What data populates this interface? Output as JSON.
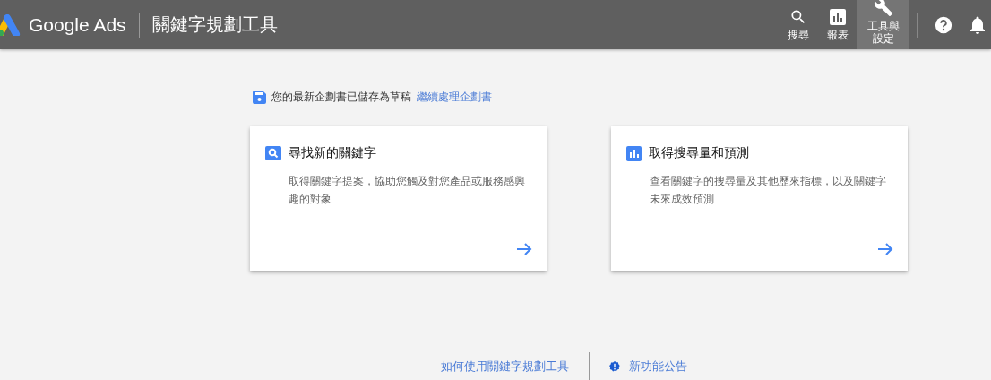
{
  "header": {
    "product": "Google Ads",
    "page_title": "關鍵字規劃工具",
    "nav": [
      {
        "kind": "search",
        "label": "搜尋",
        "selected": false
      },
      {
        "kind": "reports",
        "label": "報表",
        "selected": false
      },
      {
        "kind": "tools",
        "label": "工具與設定",
        "selected": true
      }
    ],
    "actions": [
      {
        "kind": "help"
      },
      {
        "kind": "bell"
      }
    ]
  },
  "draft_notice": {
    "text": "您的最新企劃書已儲存為草稿",
    "link": "繼續處理企劃書"
  },
  "cards": [
    {
      "kind": "search",
      "title": "尋找新的關鍵字",
      "description": "取得關鍵字提案，協助您觸及對您產品或服務感興趣的對象"
    },
    {
      "kind": "chart",
      "title": "取得搜尋量和預測",
      "description": "查看關鍵字的搜尋量及其他歷來指標，以及關鍵字未來成效預測"
    }
  ],
  "footer": {
    "help_link": "如何使用關鍵字規劃工具",
    "news_link": "新功能公告"
  }
}
